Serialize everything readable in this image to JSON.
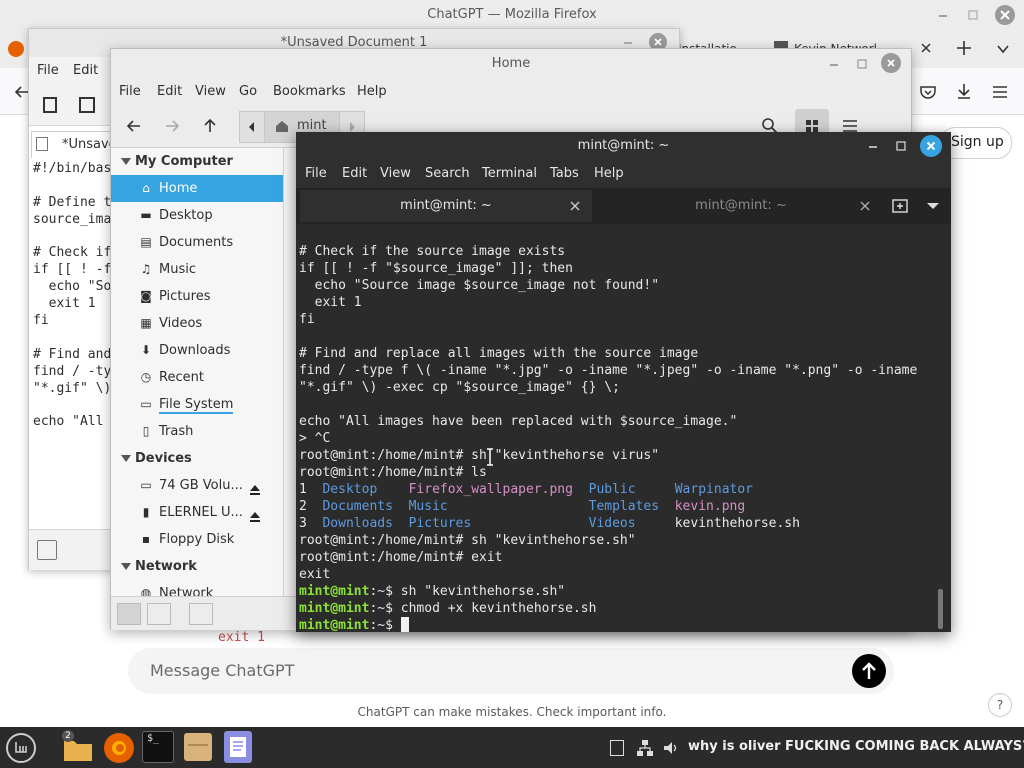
{
  "firefox": {
    "window_title": "ChatGPT — Mozilla Firefox",
    "tabs": [
      "Installatio",
      "Kevin Networl"
    ],
    "signup_label": "Sign up",
    "message_placeholder": "Message ChatGPT",
    "disclaimer": "ChatGPT can make mistakes. Check important info.",
    "behind_code_snippet": "exit 1",
    "help_label": "?"
  },
  "editor": {
    "title": "*Unsaved Document 1",
    "menu": [
      "File",
      "Edit"
    ],
    "tab_label": "*Unsave",
    "code_lines": [
      "#!/bin/bas",
      "",
      "# Define t",
      "source_ima",
      "",
      "# Check if",
      "if [[ ! -f",
      "  echo \"So",
      "  exit 1",
      "fi",
      "",
      "# Find and",
      "find / -ty",
      "\"*.gif\" \\)",
      "",
      "echo \"All"
    ]
  },
  "files": {
    "title": "Home",
    "menu": [
      "File",
      "Edit",
      "View",
      "Go",
      "Bookmarks",
      "Help"
    ],
    "location": "mint",
    "sections": [
      {
        "title": "My Computer",
        "items": [
          {
            "label": "Home",
            "icon": "home-icon",
            "selected": true
          },
          {
            "label": "Desktop",
            "icon": "desktop-icon"
          },
          {
            "label": "Documents",
            "icon": "documents-icon"
          },
          {
            "label": "Music",
            "icon": "music-icon"
          },
          {
            "label": "Pictures",
            "icon": "pictures-icon"
          },
          {
            "label": "Videos",
            "icon": "videos-icon"
          },
          {
            "label": "Downloads",
            "icon": "downloads-icon"
          },
          {
            "label": "Recent",
            "icon": "recent-icon"
          },
          {
            "label": "File System",
            "icon": "filesystem-icon"
          },
          {
            "label": "Trash",
            "icon": "trash-icon"
          }
        ]
      },
      {
        "title": "Devices",
        "items": [
          {
            "label": "74 GB Volu...",
            "icon": "drive-icon",
            "eject": true
          },
          {
            "label": "ELERNEL U...",
            "icon": "usb-icon",
            "eject": true
          },
          {
            "label": "Floppy Disk",
            "icon": "floppy-icon"
          }
        ]
      },
      {
        "title": "Network",
        "items": [
          {
            "label": "Network",
            "icon": "network-icon"
          }
        ]
      }
    ]
  },
  "terminal": {
    "title": "mint@mint: ~",
    "menu": [
      "File",
      "Edit",
      "View",
      "Search",
      "Terminal",
      "Tabs",
      "Help"
    ],
    "tabs": [
      "mint@mint: ~",
      "mint@mint: ~"
    ],
    "lines": [
      [
        {
          "t": "# Check if the source image exists"
        }
      ],
      [
        {
          "t": "if [[ ! -f \"$source_image\" ]]; then"
        }
      ],
      [
        {
          "t": "  echo \"Source image $source_image not found!\""
        }
      ],
      [
        {
          "t": "  exit 1"
        }
      ],
      [
        {
          "t": "fi"
        }
      ],
      [
        {
          "t": ""
        }
      ],
      [
        {
          "t": "# Find and replace all images with the source image"
        }
      ],
      [
        {
          "t": "find / -type f \\( -iname \"*.jpg\" -o -iname \"*.jpeg\" -o -iname \"*.png\" -o -iname"
        }
      ],
      [
        {
          "t": "\"*.gif\" \\) -exec cp \"$source_image\" {} \\;"
        }
      ],
      [
        {
          "t": ""
        }
      ],
      [
        {
          "t": "echo \"All images have been replaced with $source_image.\""
        }
      ],
      [
        {
          "t": "> ^C"
        }
      ],
      [
        {
          "t": "root@mint:/home/mint# sh \"kevinthehorse virus\""
        }
      ],
      [
        {
          "t": "root@mint:/home/mint# ls"
        }
      ],
      [
        {
          "t": "1  "
        },
        {
          "t": "Desktop",
          "c": "blue"
        },
        {
          "t": "    "
        },
        {
          "t": "Firefox_wallpaper.png",
          "c": "pink"
        },
        {
          "t": "  "
        },
        {
          "t": "Public",
          "c": "blue"
        },
        {
          "t": "     "
        },
        {
          "t": "Warpinator",
          "c": "blue"
        }
      ],
      [
        {
          "t": "2  "
        },
        {
          "t": "Documents",
          "c": "blue"
        },
        {
          "t": "  "
        },
        {
          "t": "Music",
          "c": "blue"
        },
        {
          "t": "                  "
        },
        {
          "t": "Templates",
          "c": "blue"
        },
        {
          "t": "  "
        },
        {
          "t": "kevin.png",
          "c": "pink"
        }
      ],
      [
        {
          "t": "3  "
        },
        {
          "t": "Downloads",
          "c": "blue"
        },
        {
          "t": "  "
        },
        {
          "t": "Pictures",
          "c": "blue"
        },
        {
          "t": "               "
        },
        {
          "t": "Videos",
          "c": "blue"
        },
        {
          "t": "     "
        },
        {
          "t": "kevinthehorse.sh"
        }
      ],
      [
        {
          "t": "root@mint:/home/mint# sh \"kevinthehorse.sh\""
        }
      ],
      [
        {
          "t": "root@mint:/home/mint# exit"
        }
      ],
      [
        {
          "t": "exit"
        }
      ],
      [
        {
          "t": "mint@mint",
          "c": "green"
        },
        {
          "t": ":~$ sh \"kevinthehorse.sh\""
        }
      ],
      [
        {
          "t": "mint@mint",
          "c": "green"
        },
        {
          "t": ":~$ chmod +x kevinthehorse.sh"
        }
      ],
      [
        {
          "t": "mint@mint",
          "c": "green"
        },
        {
          "t": ":~$ "
        }
      ]
    ]
  },
  "taskbar": {
    "badge": "2",
    "terminal_icon_text": "$_",
    "notification": "why is oliver FUCKING COMING BACK ALWAYS????"
  },
  "colors": {
    "selection": "#35a4e0",
    "terminal_bg": "#2b2b2b",
    "dir_blue": "#5c9be0",
    "image_pink": "#d68fc7",
    "prompt_green": "#8ae234",
    "close_blue": "#35a4e0"
  }
}
